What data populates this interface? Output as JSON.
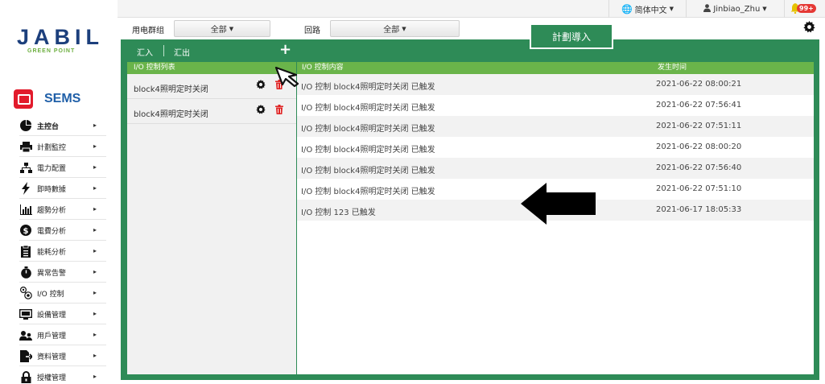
{
  "brand": {
    "logo": "JABIL",
    "logo_sub": "GREEN POINT",
    "app_name": "SEMS"
  },
  "sidebar": {
    "items": [
      {
        "label": "主控台",
        "icon": "pie-chart-icon"
      },
      {
        "label": "計劃監控",
        "icon": "printer-icon"
      },
      {
        "label": "電力配置",
        "icon": "sitemap-icon"
      },
      {
        "label": "即時數據",
        "icon": "bolt-icon"
      },
      {
        "label": "趨勢分析",
        "icon": "bar-chart-icon"
      },
      {
        "label": "電費分析",
        "icon": "dollar-icon"
      },
      {
        "label": "能耗分析",
        "icon": "clipboard-icon"
      },
      {
        "label": "異常告警",
        "icon": "stopwatch-icon"
      },
      {
        "label": "I/O 控制",
        "icon": "io-control-icon"
      },
      {
        "label": "設備管理",
        "icon": "monitor-icon"
      },
      {
        "label": "用戶管理",
        "icon": "users-icon"
      },
      {
        "label": "資料管理",
        "icon": "file-export-icon"
      },
      {
        "label": "授權管理",
        "icon": "lock-icon"
      }
    ]
  },
  "topbar": {
    "language": "简体中文",
    "user": "Jinbiao_Zhu",
    "alert_count": "99+"
  },
  "filters": {
    "group_label": "用电群组",
    "group_value": "全部",
    "circuit_label": "回路",
    "circuit_value": "全部"
  },
  "toolbar": {
    "import_label": "汇入",
    "export_label": "汇出",
    "add_label": "+",
    "plan_import_label": "計劃導入"
  },
  "left_panel": {
    "header": "I/O 控制列表",
    "items": [
      {
        "name": "block4照明定时关闭"
      },
      {
        "name": "block4照明定时关闭"
      }
    ]
  },
  "right_panel": {
    "header_content": "I/O 控制内容",
    "header_time": "发生时间",
    "rows": [
      {
        "content": "I/O 控制 block4照明定时关闭 已触发",
        "time": "2021-06-22 08:00:21"
      },
      {
        "content": "I/O 控制 block4照明定时关闭 已触发",
        "time": "2021-06-22 07:56:41"
      },
      {
        "content": "I/O 控制 block4照明定时关闭 已触发",
        "time": "2021-06-22 07:51:11"
      },
      {
        "content": "I/O 控制 block4照明定时关闭 已触发",
        "time": "2021-06-22 08:00:20"
      },
      {
        "content": "I/O 控制 block4照明定时关闭 已触发",
        "time": "2021-06-22 07:56:40"
      },
      {
        "content": "I/O 控制 block4照明定时关闭 已触发",
        "time": "2021-06-22 07:51:10"
      },
      {
        "content": "I/O 控制 123 已触发",
        "time": "2021-06-17 18:05:33"
      }
    ]
  }
}
